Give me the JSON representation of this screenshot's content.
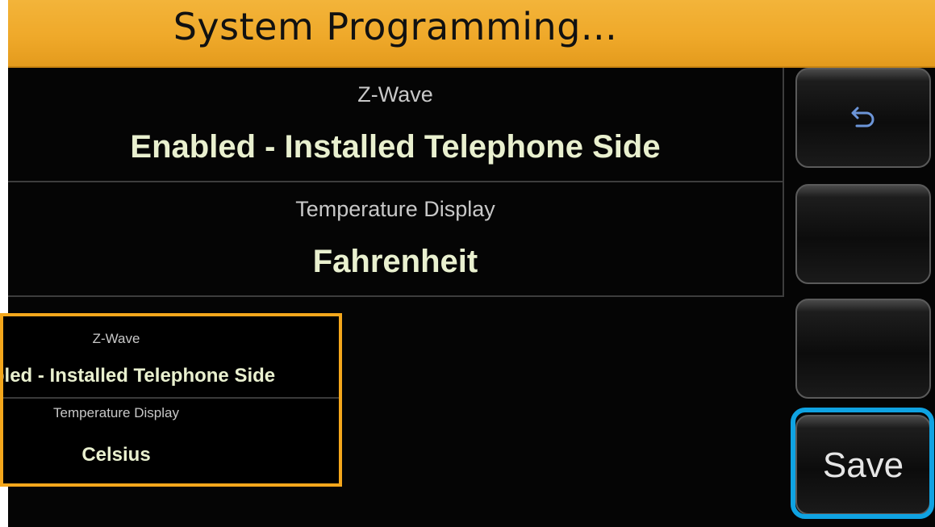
{
  "title": "System Programming...",
  "settings": [
    {
      "label": "Z-Wave",
      "value": "Enabled - Installed Telephone Side"
    },
    {
      "label": "Temperature Display",
      "value": "Fahrenheit"
    }
  ],
  "buttons": {
    "back_icon": "back-arrow-icon",
    "save_label": "Save",
    "accent_color": "#0fa3e2"
  },
  "inset": {
    "rows": [
      {
        "label": "Z-Wave",
        "value": "Enabled - Installed Telephone Side"
      },
      {
        "label": "Temperature Display",
        "value": "Celsius"
      }
    ],
    "border_color": "#f4a71c"
  }
}
